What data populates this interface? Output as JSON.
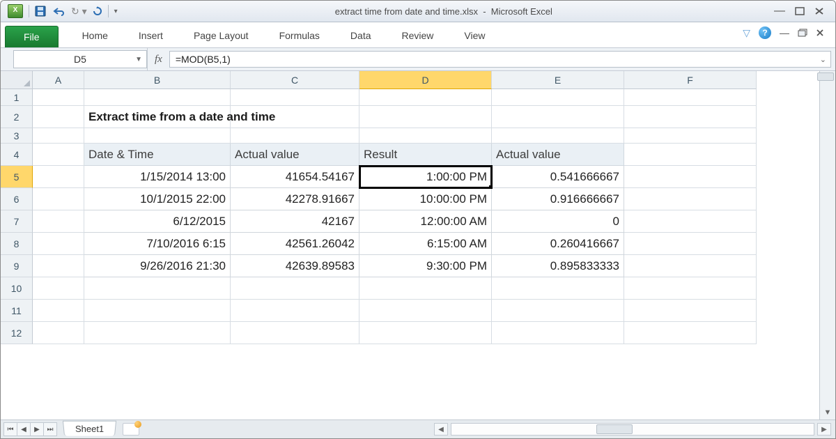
{
  "titlebar": {
    "filename": "extract time from date and time.xlsx",
    "app": "Microsoft Excel"
  },
  "ribbon": {
    "file": "File",
    "tabs": [
      "Home",
      "Insert",
      "Page Layout",
      "Formulas",
      "Data",
      "Review",
      "View"
    ]
  },
  "namebox": "D5",
  "formula": "=MOD(B5,1)",
  "columns": [
    "A",
    "B",
    "C",
    "D",
    "E",
    "F"
  ],
  "active_col_index": 3,
  "row_count": 12,
  "active_row": 5,
  "content": {
    "title": "Extract time from a date and time",
    "headers": [
      "Date & Time",
      "Actual value",
      "Result",
      "Actual value"
    ],
    "rows": [
      {
        "b": "1/15/2014 13:00",
        "c": "41654.54167",
        "d": "1:00:00 PM",
        "e": "0.541666667"
      },
      {
        "b": "10/1/2015 22:00",
        "c": "42278.91667",
        "d": "10:00:00 PM",
        "e": "0.916666667"
      },
      {
        "b": "6/12/2015",
        "c": "42167",
        "d": "12:00:00 AM",
        "e": "0"
      },
      {
        "b": "7/10/2016 6:15",
        "c": "42561.26042",
        "d": "6:15:00 AM",
        "e": "0.260416667"
      },
      {
        "b": "9/26/2016 21:30",
        "c": "42639.89583",
        "d": "9:30:00 PM",
        "e": "0.895833333"
      }
    ]
  },
  "sheet": {
    "name": "Sheet1"
  }
}
